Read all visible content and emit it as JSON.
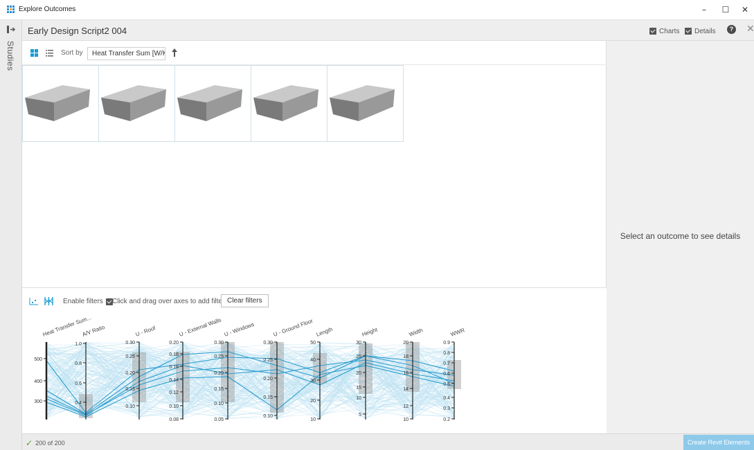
{
  "window": {
    "title": "Explore Outcomes",
    "minimize": "–",
    "maximize": "☐",
    "close": "✕"
  },
  "rail": {
    "label": "Studies"
  },
  "header": {
    "study_title": "Early Design Script2 004",
    "charts_label": "Charts",
    "details_label": "Details",
    "help": "?",
    "close": "✕",
    "charts_checked": true,
    "details_checked": true
  },
  "toolbar": {
    "sort_by_label": "Sort by",
    "sort_value": "Heat Transfer Sum [W/K]",
    "sort_direction": "ascending"
  },
  "outcomes": [
    {
      "shape": "box"
    },
    {
      "shape": "box"
    },
    {
      "shape": "box"
    },
    {
      "shape": "box"
    },
    {
      "shape": "box"
    }
  ],
  "parallel": {
    "enable_filters_label": "Enable filters",
    "enable_filters_checked": true,
    "hint": "Click and drag over axes to add filters",
    "clear_filters": "Clear filters",
    "axes": [
      {
        "label": "Heat Transfer Sum...",
        "ticks": [
          "500",
          "400",
          "300"
        ]
      },
      {
        "label": "A/V Ratio",
        "ticks": [
          "1.0",
          "0.8",
          "0.6",
          "0.4"
        ]
      },
      {
        "label": "U - Roof",
        "ticks": [
          "0.30",
          "0.25",
          "0.20",
          "0.15",
          "0.10"
        ]
      },
      {
        "label": "U - External Walls",
        "ticks": [
          "0.20",
          "0.18",
          "0.16",
          "0.14",
          "0.12",
          "0.10",
          "0.08"
        ]
      },
      {
        "label": "U - Windows",
        "ticks": [
          "0.30",
          "0.25",
          "0.20",
          "0.15",
          "0.10",
          "0.05"
        ]
      },
      {
        "label": "U - Ground Floor",
        "ticks": [
          "0.30",
          "0.25",
          "0.20",
          "0.15",
          "0.10"
        ]
      },
      {
        "label": "Length",
        "ticks": [
          "50",
          "40",
          "30",
          "20",
          "10"
        ]
      },
      {
        "label": "Height",
        "ticks": [
          "30",
          "25",
          "20",
          "15",
          "10",
          "5"
        ]
      },
      {
        "label": "Width",
        "ticks": [
          "20",
          "18",
          "16",
          "14",
          "12",
          "10"
        ]
      },
      {
        "label": "WWR",
        "ticks": [
          "0.9",
          "0.8",
          "0.7",
          "0.6",
          "0.5",
          "0.4",
          "0.3",
          "0.2"
        ]
      }
    ]
  },
  "details": {
    "empty_message": "Select an outcome to see details"
  },
  "status": {
    "count": "200 of 200",
    "create_button": "Create Revit Elements"
  },
  "colors": {
    "accent": "#1a9cd3",
    "line_light": "#bfe3f2",
    "line_selected": "#2a9ccf",
    "button_disabled": "#8ec9ea"
  }
}
